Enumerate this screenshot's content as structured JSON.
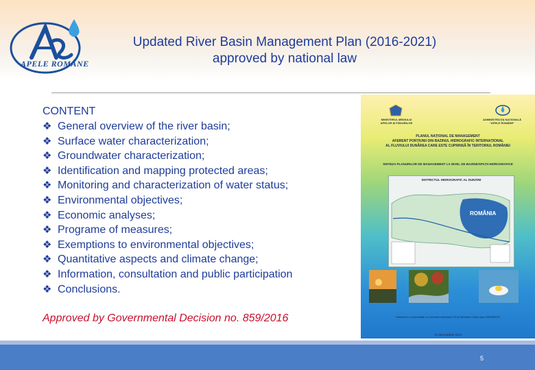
{
  "logo": {
    "text": "APELE ROMÂNE"
  },
  "title": {
    "line1": "Updated River Basin Management Plan (2016-2021)",
    "line2": "approved by national law"
  },
  "content": {
    "heading": "CONTENT",
    "bullet_symbol": "❖",
    "items": [
      "General overview of the river basin;",
      "Surface water characterization;",
      "Groundwater characterization;",
      "Identification and mapping protected areas;",
      "Monitoring and characterization of water status;",
      "Environmental objectives;",
      "Economic analyses;",
      "Programe of measures;",
      "Exemptions to environmental objectives;",
      "Quantitative aspects and climate change;",
      "Information, consultation and public participation",
      "Conclusions."
    ]
  },
  "approval": "Approved by Governmental Decision no. 859/2016",
  "cover": {
    "ministry": "MINISTERUL MEDIULUI\nAPELOR ȘI PĂDURILOR",
    "administration": "ADMINISTRAȚIA NAȚIONALĂ\n\"APELE ROMÂNE\"",
    "main_title_1": "PLANUL NAȚIONAL DE MANAGEMENT",
    "main_title_2": "AFERENT PORȚIUNII DIN BAZINUL HIDROGRAFIC INTERNAȚIONAL",
    "main_title_3": "AL FLUVIULUI DUNĂREA CARE ESTE CUPRINSĂ ÎN TERITORIUL ROMÂNIEI",
    "subtitle": "SINTEZA PLANURILOR DE MANAGEMENT LA NIVEL DE BAZINE/SPAȚII HIDROGRAFICE",
    "map_title": "DISTRICTUL HIDROGRAFIC AL DUNĂRII",
    "map_label": "ROMÂNIA",
    "footnote": "Elaborat în conformitate cu cerințele Articolului 13 al Directivei Cadru Apa 2000/60/CE",
    "date": "22 DECEMBRIE 2015"
  },
  "page_number": "5",
  "colors": {
    "title": "#1f3c99",
    "approval": "#c8102e",
    "bottom_band": "#4a7ec6"
  }
}
